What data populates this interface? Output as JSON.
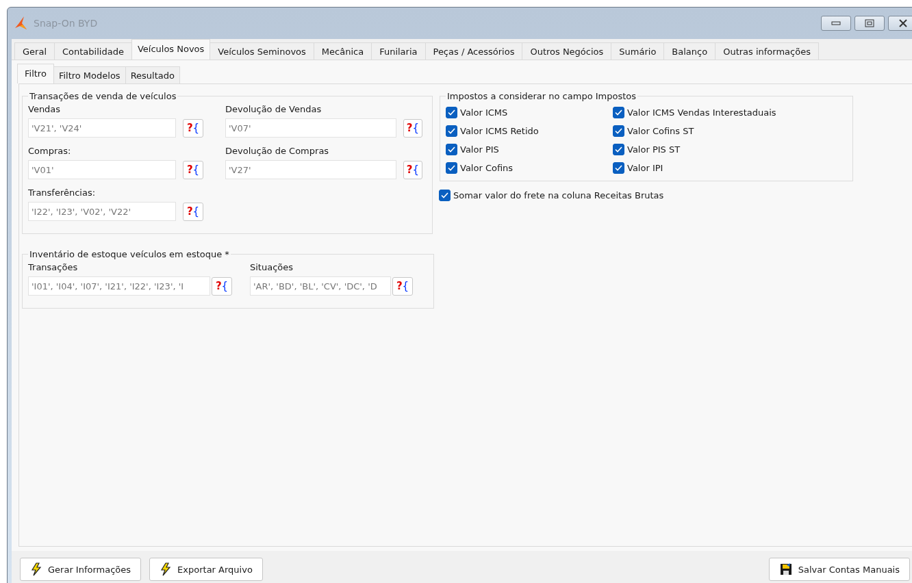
{
  "window": {
    "title": "Snap-On BYD"
  },
  "tabs": [
    {
      "label": "Geral",
      "selected": false
    },
    {
      "label": "Contabilidade",
      "selected": false
    },
    {
      "label": "Veículos Novos",
      "selected": true
    },
    {
      "label": "Veículos Seminovos",
      "selected": false
    },
    {
      "label": "Mecânica",
      "selected": false
    },
    {
      "label": "Funilaria",
      "selected": false
    },
    {
      "label": "Peças / Acessórios",
      "selected": false
    },
    {
      "label": "Outros Negócios",
      "selected": false
    },
    {
      "label": "Sumário",
      "selected": false
    },
    {
      "label": "Balanço",
      "selected": false
    },
    {
      "label": "Outras informações",
      "selected": false
    }
  ],
  "subtabs": [
    {
      "label": "Filtro",
      "selected": true
    },
    {
      "label": "Filtro Modelos",
      "selected": false
    },
    {
      "label": "Resultado",
      "selected": false
    }
  ],
  "sales_group": {
    "title": "Transações de venda de veículos",
    "fields": [
      {
        "label": "Vendas",
        "value": "'V21', 'V24'",
        "lookup": [
          "?",
          "{"
        ]
      },
      {
        "label": "Devolução de Vendas",
        "value": "'V07'",
        "lookup": [
          "?",
          "{"
        ]
      },
      {
        "label": "Compras:",
        "value": "'V01'",
        "lookup": [
          "?",
          "{"
        ]
      },
      {
        "label": "Devolução de Compras",
        "value": "'V27'",
        "lookup": [
          "?",
          "{"
        ]
      },
      {
        "label": "Transferências:",
        "value": "'I22', 'I23', 'V02', 'V22'",
        "lookup": [
          "?",
          "{"
        ]
      }
    ]
  },
  "inventory_group": {
    "title": "Inventário de estoque veículos em estoque *",
    "fields": [
      {
        "label": "Transações",
        "value": "'I01', 'I04', 'I07', 'I21', 'I22', 'I23', 'I",
        "lookup": [
          "?",
          "{"
        ]
      },
      {
        "label": "Situações",
        "value": "'AR', 'BD', 'BL', 'CV', 'DC', 'D",
        "lookup": [
          "?",
          "{"
        ]
      }
    ]
  },
  "taxes_group": {
    "title": "Impostos a considerar no campo Impostos",
    "options": [
      {
        "label": "Valor ICMS",
        "checked": true
      },
      {
        "label": "Valor ICMS Vendas Interestaduais",
        "checked": true
      },
      {
        "label": "Valor ICMS Retido",
        "checked": true
      },
      {
        "label": "Valor Cofins ST",
        "checked": true
      },
      {
        "label": "Valor PIS",
        "checked": true
      },
      {
        "label": "Valor PIS ST",
        "checked": true
      },
      {
        "label": "Valor Cofins",
        "checked": true
      },
      {
        "label": "Valor IPI",
        "checked": true
      }
    ]
  },
  "freight_option": {
    "label": "Somar valor do frete na coluna Receitas Brutas",
    "checked": true
  },
  "buttons": [
    {
      "label": "Gerar Informações",
      "kind": "bolt"
    },
    {
      "label": "Exportar Arquivo",
      "kind": "bolt"
    },
    {
      "label": "Salvar Contas Manuais",
      "kind": "disk"
    }
  ]
}
